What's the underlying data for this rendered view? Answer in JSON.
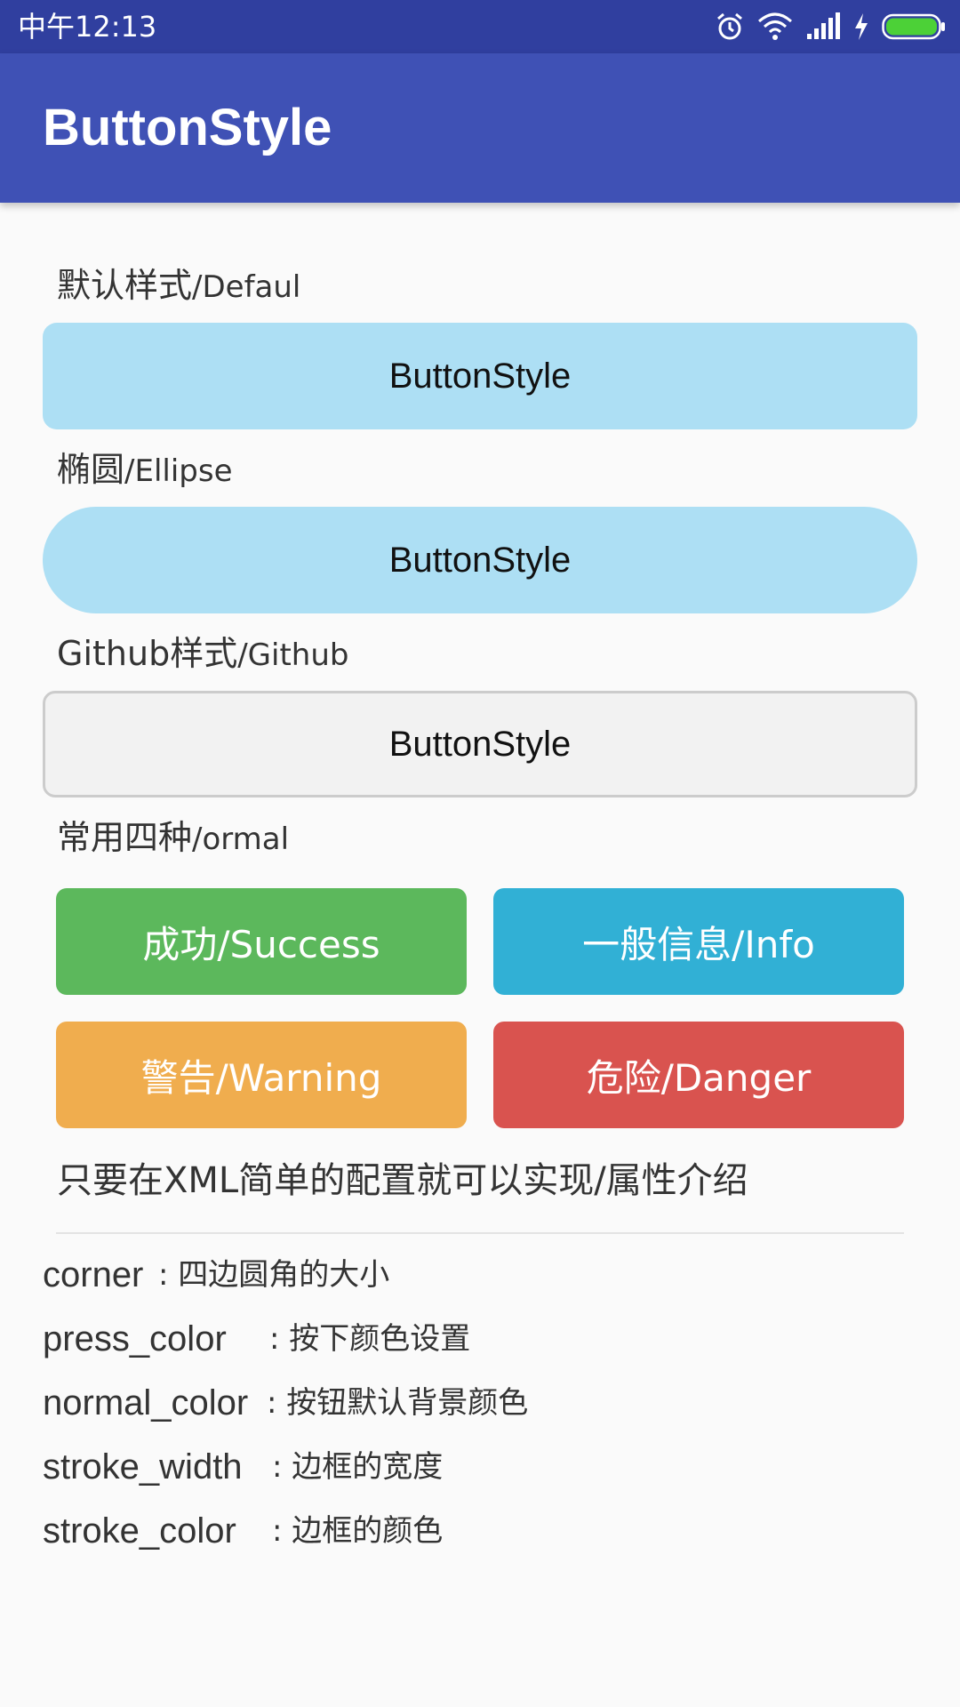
{
  "status_bar": {
    "time": "中午12:13",
    "icons": [
      "alarm-icon",
      "wifi-icon",
      "signal-icon",
      "charging-icon",
      "battery-icon"
    ],
    "battery_color": "#4cd137"
  },
  "app_bar": {
    "title": "ButtonStyle",
    "color": "#3f51b5"
  },
  "sections": {
    "default": {
      "label_cn": "默认样式",
      "label_en": "/Defaul",
      "button": "ButtonStyle"
    },
    "ellipse": {
      "label_cn": "椭圆",
      "label_en": "/Ellipse",
      "button": "ButtonStyle"
    },
    "github": {
      "label_cn": "Github样式",
      "label_en": "/Github",
      "button": "ButtonStyle"
    },
    "normal": {
      "label_cn": "常用四种",
      "label_en": "/ormal"
    }
  },
  "color_buttons": {
    "success": {
      "label": "成功/Success",
      "color": "#5cb85c"
    },
    "info": {
      "label": "一般信息/Info",
      "color": "#31b0d5"
    },
    "warning": {
      "label": "警告/Warning",
      "color": "#f0ad4e"
    },
    "danger": {
      "label": "危险/Danger",
      "color": "#d9534f"
    }
  },
  "note": "只要在XML简单的配置就可以实现/属性介绍",
  "attributes": [
    {
      "name": "corner",
      "desc": ": 四边圆角的大小"
    },
    {
      "name": "press_color",
      "desc": ": 按下颜色设置"
    },
    {
      "name": "normal_color",
      "desc": ": 按钮默认背景颜色"
    },
    {
      "name": "stroke_width",
      "desc": ": 边框的宽度"
    },
    {
      "name": "stroke_color",
      "desc": ": 边框的颜色"
    }
  ]
}
